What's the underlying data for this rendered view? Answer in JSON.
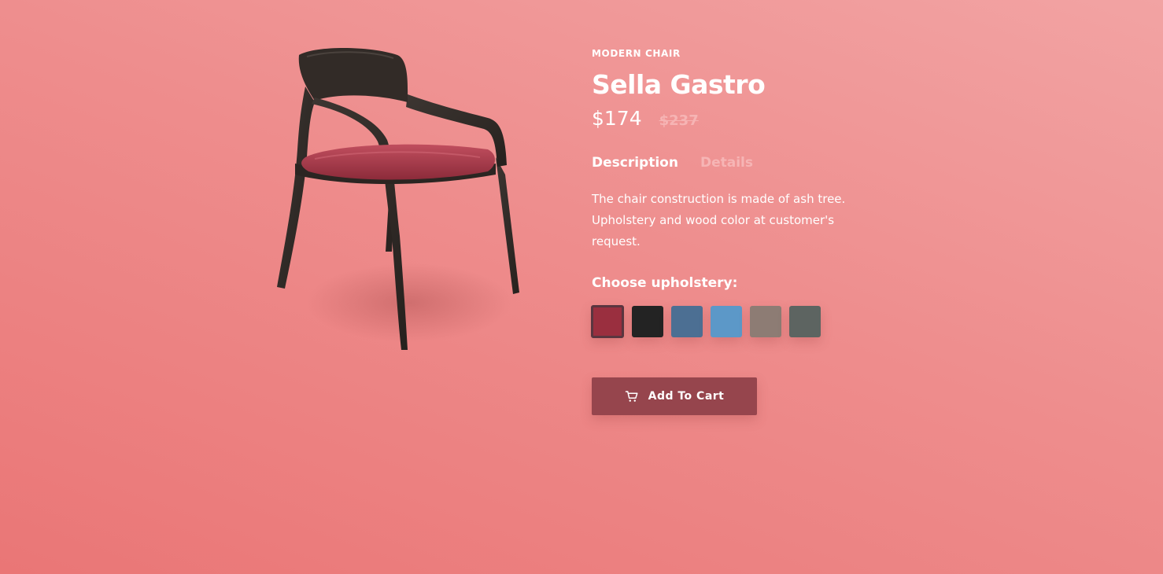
{
  "product": {
    "category": "MODERN CHAIR",
    "name": "Sella Gastro",
    "price": "$174",
    "old_price": "$237",
    "image_icon": "chair-image"
  },
  "tabs": [
    {
      "label": "Description",
      "active": true
    },
    {
      "label": "Details",
      "active": false
    }
  ],
  "description": "The chair construction is made of ash tree. Upholstery and wood color at customer's request.",
  "upholstery": {
    "label": "Choose upholstery:",
    "selected_index": 0,
    "options": [
      {
        "color": "#9a2f3f"
      },
      {
        "color": "#232323"
      },
      {
        "color": "#4c6f93"
      },
      {
        "color": "#5c98c8"
      },
      {
        "color": "#8d7c74"
      },
      {
        "color": "#5d6461"
      }
    ]
  },
  "cart": {
    "label": "Add To Cart",
    "icon": "cart-icon"
  },
  "colors": {
    "button_bg": "#96454d",
    "inactive_tab": "#f6b5b5",
    "old_price": "#f6b4b4"
  }
}
